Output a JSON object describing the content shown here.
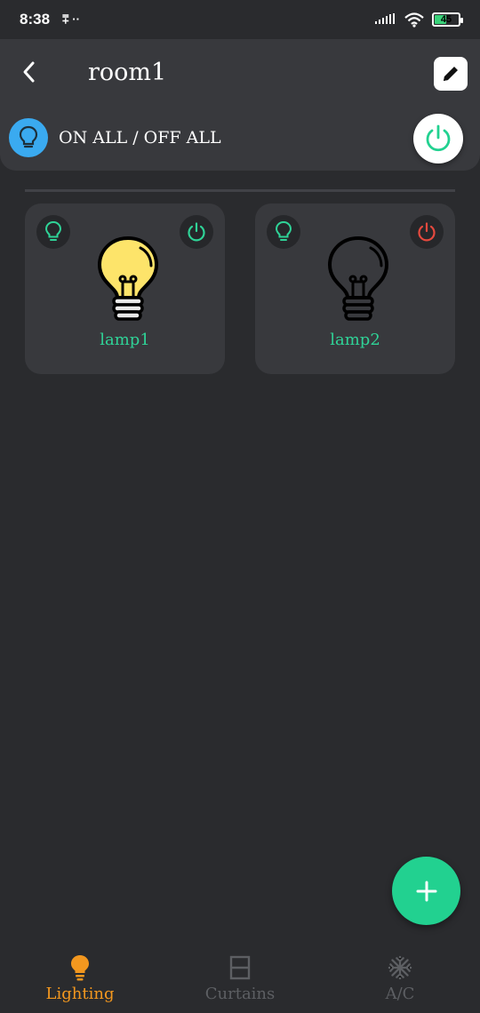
{
  "status_bar": {
    "time": "8:38",
    "notif_icons": "⩱ ··",
    "battery_level": "45"
  },
  "header": {
    "title": "room1",
    "all_label": "ON ALL / OFF ALL"
  },
  "lamps": [
    {
      "name": "lamp1",
      "state": "on",
      "power_color": "#2fd397",
      "bulb_color": "#fde46a"
    },
    {
      "name": "lamp2",
      "state": "off",
      "power_color": "#e5493e",
      "bulb_color": "none"
    }
  ],
  "bottom_nav": {
    "items": [
      {
        "label": "Lighting",
        "icon": "bulb-icon",
        "active": true
      },
      {
        "label": "Curtains",
        "icon": "curtain-icon",
        "active": false
      },
      {
        "label": "A/C",
        "icon": "snowflake-icon",
        "active": false
      }
    ]
  },
  "colors": {
    "accent_green": "#22d190",
    "accent_orange": "#f2971f",
    "bulb_blue": "#3aaaf0",
    "off_red": "#e5493e"
  }
}
